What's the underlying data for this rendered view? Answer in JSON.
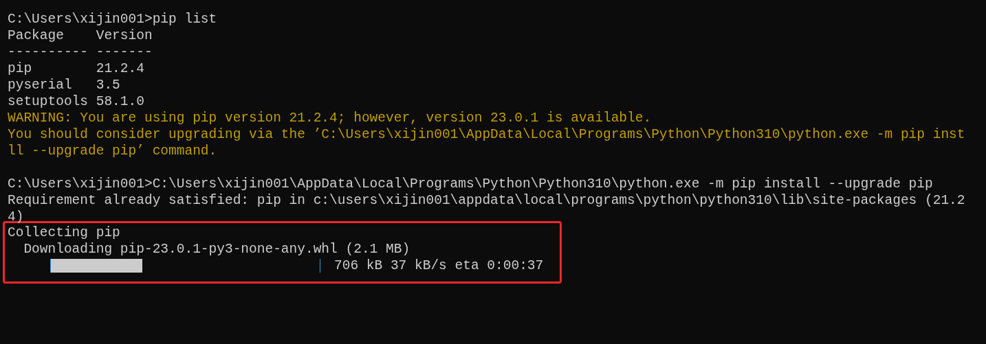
{
  "console": {
    "lines": [
      {
        "kind": "output",
        "text": "C:\\Users\\xijin001>pip list"
      },
      {
        "kind": "output",
        "text": "Package    Version"
      },
      {
        "kind": "output",
        "text": "---------- -------"
      },
      {
        "kind": "output",
        "text": "pip        21.2.4"
      },
      {
        "kind": "output",
        "text": "pyserial   3.5"
      },
      {
        "kind": "output",
        "text": "setuptools 58.1.0"
      },
      {
        "kind": "warning",
        "text": "WARNING: You are using pip version 21.2.4; however, version 23.0.1 is available."
      },
      {
        "kind": "warning",
        "text": "You should consider upgrading via the ’C:\\Users\\xijin001\\AppData\\Local\\Programs\\Python\\Python310\\python.exe -m pip inst"
      },
      {
        "kind": "warning",
        "text": "ll --upgrade pip’ command."
      },
      {
        "kind": "blank"
      },
      {
        "kind": "output",
        "text": "C:\\Users\\xijin001>C:\\Users\\xijin001\\AppData\\Local\\Programs\\Python\\Python310\\python.exe -m pip install --upgrade pip"
      },
      {
        "kind": "output",
        "text": "Requirement already satisfied: pip in c:\\users\\xijin001\\appdata\\local\\programs\\python\\python310\\lib\\site-packages (21.2"
      },
      {
        "kind": "output",
        "text": "4)"
      }
    ]
  },
  "highlighted": {
    "lines": [
      {
        "kind": "output",
        "text": "Collecting pip"
      },
      {
        "kind": "output",
        "text": "  Downloading pip-23.0.1-py3-none-any.whl (2.1 MB)"
      }
    ],
    "progress": {
      "level": 0.34,
      "reading": "706 kB 37 kB/s eta 0:00:37"
    }
  }
}
